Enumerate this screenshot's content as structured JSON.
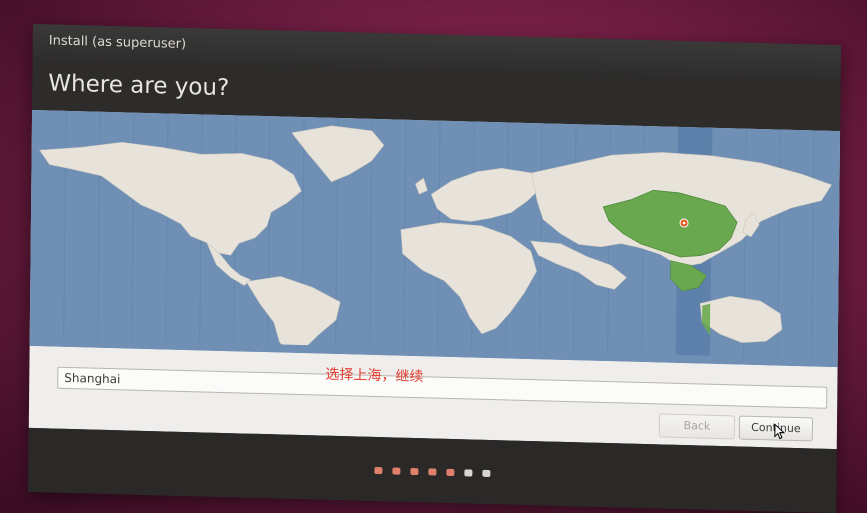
{
  "window": {
    "title": "Install (as superuser)"
  },
  "header": {
    "title": "Where are you?"
  },
  "map": {
    "selected_region": "China",
    "selected_city": "Shanghai",
    "ocean_color": "#6f8fb5",
    "land_color": "#e7e3da",
    "selected_color": "#6aa84f",
    "highlight_band_color": "#5a7fa8"
  },
  "location": {
    "value": "Shanghai"
  },
  "annotation": {
    "text": "选择上海，继续",
    "color": "#e23b2e"
  },
  "buttons": {
    "back_label": "Back",
    "continue_label": "Continue"
  },
  "progress": {
    "total_steps": 7,
    "completed_steps": 5,
    "active_color": "#e0806a",
    "inactive_color": "#d8d6d2"
  }
}
